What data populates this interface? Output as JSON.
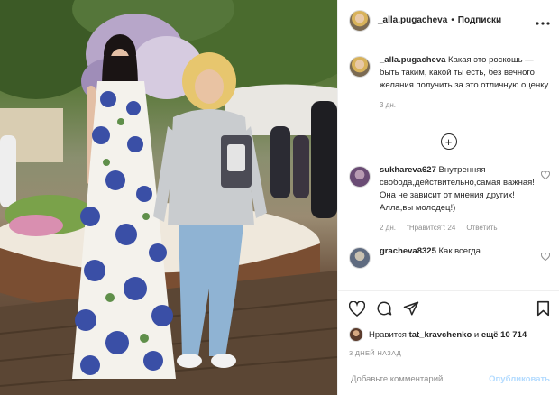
{
  "post": {
    "author": "_alla.pugacheva",
    "separator": "•",
    "follow_label": "Подписки",
    "more_icon": "more-horizontal-icon",
    "caption": {
      "username": "_alla.pugacheva",
      "text": "Какая это роскошь — быть таким, какой ты есть, без вечного желания получить за это отличную оценку.",
      "time": "3 дн."
    },
    "load_more_icon": "plus-circle-icon",
    "comments": [
      {
        "username": "sukhareva627",
        "text": "Внутренняя свобода,действительно,самая важная! Она не зависит от мнения других! Алла,вы молодец!)",
        "time": "2 дн.",
        "likes": "\"Нравится\": 24",
        "reply": "Ответить"
      },
      {
        "username": "gracheva8325",
        "text": "Как всегда"
      }
    ],
    "actions": {
      "like_icon": "heart-icon",
      "comment_icon": "comment-icon",
      "share_icon": "send-icon",
      "save_icon": "bookmark-icon"
    },
    "likes_line": {
      "prefix": "Нравится",
      "user": "tat_kravchenko",
      "middle": "и",
      "count": "ещё 10 714"
    },
    "date": "3 ДНЕЙ НАЗАД",
    "add_comment": {
      "placeholder": "Добавьте комментарий...",
      "publish_label": "Опубликовать"
    }
  },
  "colors": {
    "text": "#262626",
    "muted": "#8e8e8e",
    "border": "#efefef",
    "publish_disabled": "#b3dbff"
  }
}
